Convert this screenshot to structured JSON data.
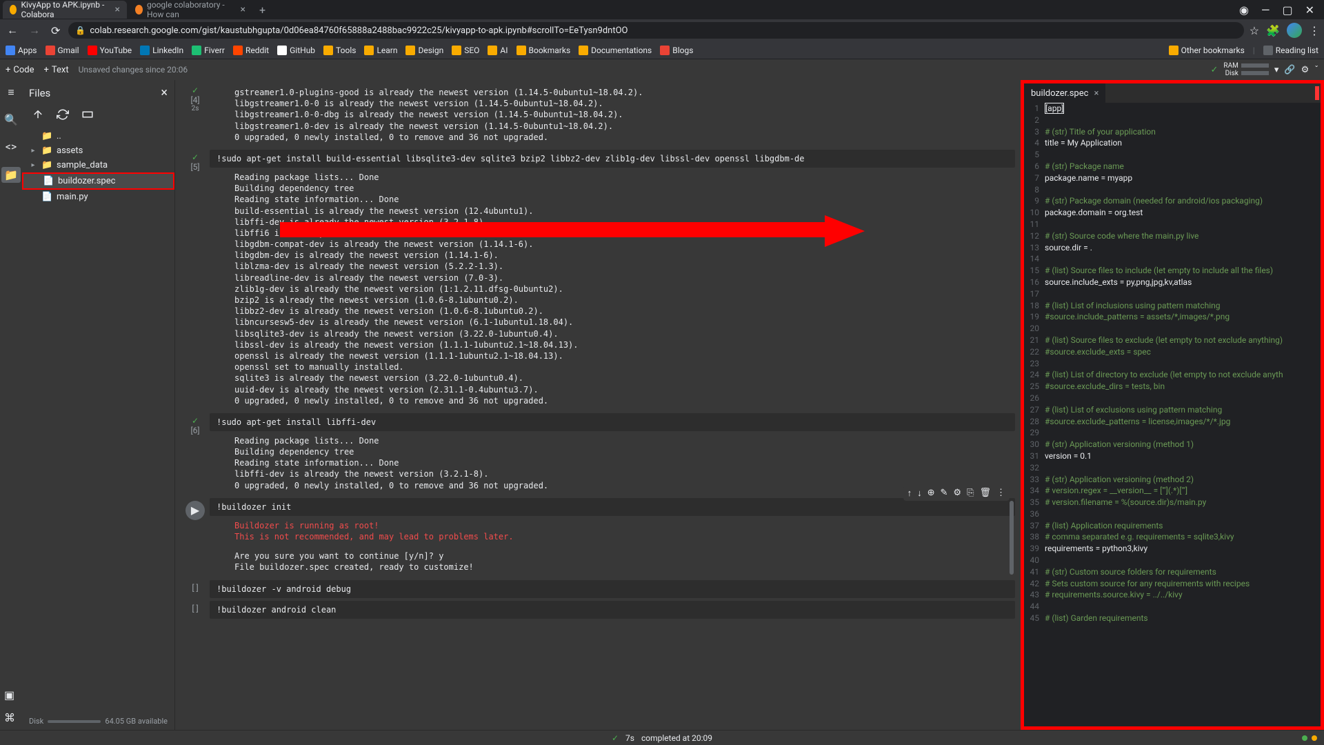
{
  "browser": {
    "tabs": [
      {
        "title": "KivyApp to APK.ipynb - Colabora",
        "icon": "colab"
      },
      {
        "title": "google colaboratory - How can",
        "icon": "stack"
      }
    ],
    "url": "colab.research.google.com/gist/kaustubhgupta/0d06ea84760f65888a2488bac9922c25/kivyapp-to-apk.ipynb#scrollTo=EeTysn9dntOO",
    "bookmarks": [
      "Apps",
      "Gmail",
      "YouTube",
      "LinkedIn",
      "Fiverr",
      "Reddit",
      "GitHub",
      "Tools",
      "Learn",
      "Design",
      "SEO",
      "AI",
      "Bookmarks",
      "Documentations",
      "Blogs"
    ],
    "bookmarksRight": [
      "Other bookmarks",
      "Reading list"
    ]
  },
  "colab": {
    "codeBtn": "Code",
    "textBtn": "Text",
    "unsaved": "Unsaved changes since 20:06",
    "ramLabel": "RAM",
    "diskLabel": "Disk"
  },
  "files": {
    "title": "Files",
    "tree": [
      {
        "name": "..",
        "type": "up",
        "arrow": ""
      },
      {
        "name": "assets",
        "type": "folder",
        "arrow": "▸"
      },
      {
        "name": "sample_data",
        "type": "folder",
        "arrow": "▸"
      },
      {
        "name": "buildozer.spec",
        "type": "file",
        "arrow": "",
        "highlighted": true
      },
      {
        "name": "main.py",
        "type": "file",
        "arrow": ""
      }
    ],
    "disk": {
      "label": "Disk",
      "available": "64.05 GB available"
    }
  },
  "cells": [
    {
      "num": "[4]",
      "status": "✓",
      "time": "2s",
      "output": "gstreamer1.0-plugins-good is already the newest version (1.14.5-0ubuntu1~18.04.2).\nlibgstreamer1.0-0 is already the newest version (1.14.5-0ubuntu1~18.04.2).\nlibgstreamer1.0-0-dbg is already the newest version (1.14.5-0ubuntu1~18.04.2).\nlibgstreamer1.0-dev is already the newest version (1.14.5-0ubuntu1~18.04.2).\n0 upgraded, 0 newly installed, 0 to remove and 36 not upgraded."
    },
    {
      "num": "[5]",
      "status": "✓",
      "time": "",
      "code": "!sudo apt-get install build-essential libsqlite3-dev sqlite3 bzip2 libbz2-dev zlib1g-dev libssl-dev openssl libgdbm-de",
      "output": "Reading package lists... Done\nBuilding dependency tree\nReading state information... Done\nbuild-essential is already the newest version (12.4ubuntu1).\nlibffi-dev is already the newest version (3.2.1-8).\nlibffi6 is already the newest version (3.2.1-8).\nlibgdbm-compat-dev is already the newest version (1.14.1-6).\nlibgdbm-dev is already the newest version (1.14.1-6).\nliblzma-dev is already the newest version (5.2.2-1.3).\nlibreadline-dev is already the newest version (7.0-3).\nzlib1g-dev is already the newest version (1:1.2.11.dfsg-0ubuntu2).\nbzip2 is already the newest version (1.0.6-8.1ubuntu0.2).\nlibbz2-dev is already the newest version (1.0.6-8.1ubuntu0.2).\nlibncursesw5-dev is already the newest version (6.1-1ubuntu1.18.04).\nlibsqlite3-dev is already the newest version (3.22.0-1ubuntu0.4).\nlibssl-dev is already the newest version (1.1.1-1ubuntu2.1~18.04.13).\nopenssl is already the newest version (1.1.1-1ubuntu2.1~18.04.13).\nopenssl set to manually installed.\nsqlite3 is already the newest version (3.22.0-1ubuntu0.4).\nuuid-dev is already the newest version (2.31.1-0.4ubuntu3.7).\n0 upgraded, 0 newly installed, 0 to remove and 36 not upgraded."
    },
    {
      "num": "[6]",
      "status": "✓",
      "time": "",
      "code": "!sudo apt-get install libffi-dev",
      "output": "Reading package lists... Done\nBuilding dependency tree\nReading state information... Done\nlibffi-dev is already the newest version (3.2.1-8).\n0 upgraded, 0 newly installed, 0 to remove and 36 not upgraded."
    },
    {
      "num": "",
      "status": "",
      "play": true,
      "code": "!buildozer init",
      "outputRed": "Buildozer is running as root!\nThis is not recommended, and may lead to problems later.",
      "output": "Are you sure you want to continue [y/n]? y\nFile buildozer.spec created, ready to customize!",
      "toolbar": true
    },
    {
      "num": "[ ]",
      "code": "!buildozer -v android debug"
    },
    {
      "num": "[ ]",
      "code": "!buildozer android clean"
    }
  ],
  "editor": {
    "tabName": "buildozer.spec",
    "lines": [
      {
        "n": 1,
        "t": "[app]",
        "cursor": true
      },
      {
        "n": 2,
        "t": ""
      },
      {
        "n": 3,
        "t": "# (str) Title of your application",
        "c": true
      },
      {
        "n": 4,
        "t": "title = My Application"
      },
      {
        "n": 5,
        "t": ""
      },
      {
        "n": 6,
        "t": "# (str) Package name",
        "c": true
      },
      {
        "n": 7,
        "t": "package.name = myapp"
      },
      {
        "n": 8,
        "t": ""
      },
      {
        "n": 9,
        "t": "# (str) Package domain (needed for android/ios packaging)",
        "c": true
      },
      {
        "n": 10,
        "t": "package.domain = org.test"
      },
      {
        "n": 11,
        "t": ""
      },
      {
        "n": 12,
        "t": "# (str) Source code where the main.py live",
        "c": true
      },
      {
        "n": 13,
        "t": "source.dir = ."
      },
      {
        "n": 14,
        "t": ""
      },
      {
        "n": 15,
        "t": "# (list) Source files to include (let empty to include all the files)",
        "c": true
      },
      {
        "n": 16,
        "t": "source.include_exts = py,png,jpg,kv,atlas"
      },
      {
        "n": 17,
        "t": ""
      },
      {
        "n": 18,
        "t": "# (list) List of inclusions using pattern matching",
        "c": true
      },
      {
        "n": 19,
        "t": "#source.include_patterns = assets/*,images/*.png",
        "c": true
      },
      {
        "n": 20,
        "t": ""
      },
      {
        "n": 21,
        "t": "# (list) Source files to exclude (let empty to not exclude anything)",
        "c": true
      },
      {
        "n": 22,
        "t": "#source.exclude_exts = spec",
        "c": true
      },
      {
        "n": 23,
        "t": ""
      },
      {
        "n": 24,
        "t": "# (list) List of directory to exclude (let empty to not exclude anyth",
        "c": true
      },
      {
        "n": 25,
        "t": "#source.exclude_dirs = tests, bin",
        "c": true
      },
      {
        "n": 26,
        "t": ""
      },
      {
        "n": 27,
        "t": "# (list) List of exclusions using pattern matching",
        "c": true
      },
      {
        "n": 28,
        "t": "#source.exclude_patterns = license,images/*/*.jpg",
        "c": true
      },
      {
        "n": 29,
        "t": ""
      },
      {
        "n": 30,
        "t": "# (str) Application versioning (method 1)",
        "c": true
      },
      {
        "n": 31,
        "t": "version = 0.1"
      },
      {
        "n": 32,
        "t": ""
      },
      {
        "n": 33,
        "t": "# (str) Application versioning (method 2)",
        "c": true
      },
      {
        "n": 34,
        "t": "# version.regex = __version__ = ['\"](.*)['\"]",
        "c": true
      },
      {
        "n": 35,
        "t": "# version.filename = %(source.dir)s/main.py",
        "c": true
      },
      {
        "n": 36,
        "t": ""
      },
      {
        "n": 37,
        "t": "# (list) Application requirements",
        "c": true
      },
      {
        "n": 38,
        "t": "# comma separated e.g. requirements = sqlite3,kivy",
        "c": true
      },
      {
        "n": 39,
        "t": "requirements = python3,kivy"
      },
      {
        "n": 40,
        "t": ""
      },
      {
        "n": 41,
        "t": "# (str) Custom source folders for requirements",
        "c": true
      },
      {
        "n": 42,
        "t": "# Sets custom source for any requirements with recipes",
        "c": true
      },
      {
        "n": 43,
        "t": "# requirements.source.kivy = ../../kivy",
        "c": true
      },
      {
        "n": 44,
        "t": ""
      },
      {
        "n": 45,
        "t": "# (list) Garden requirements",
        "c": true
      }
    ]
  },
  "status": {
    "time": "7s",
    "text": "completed at 20:09"
  }
}
